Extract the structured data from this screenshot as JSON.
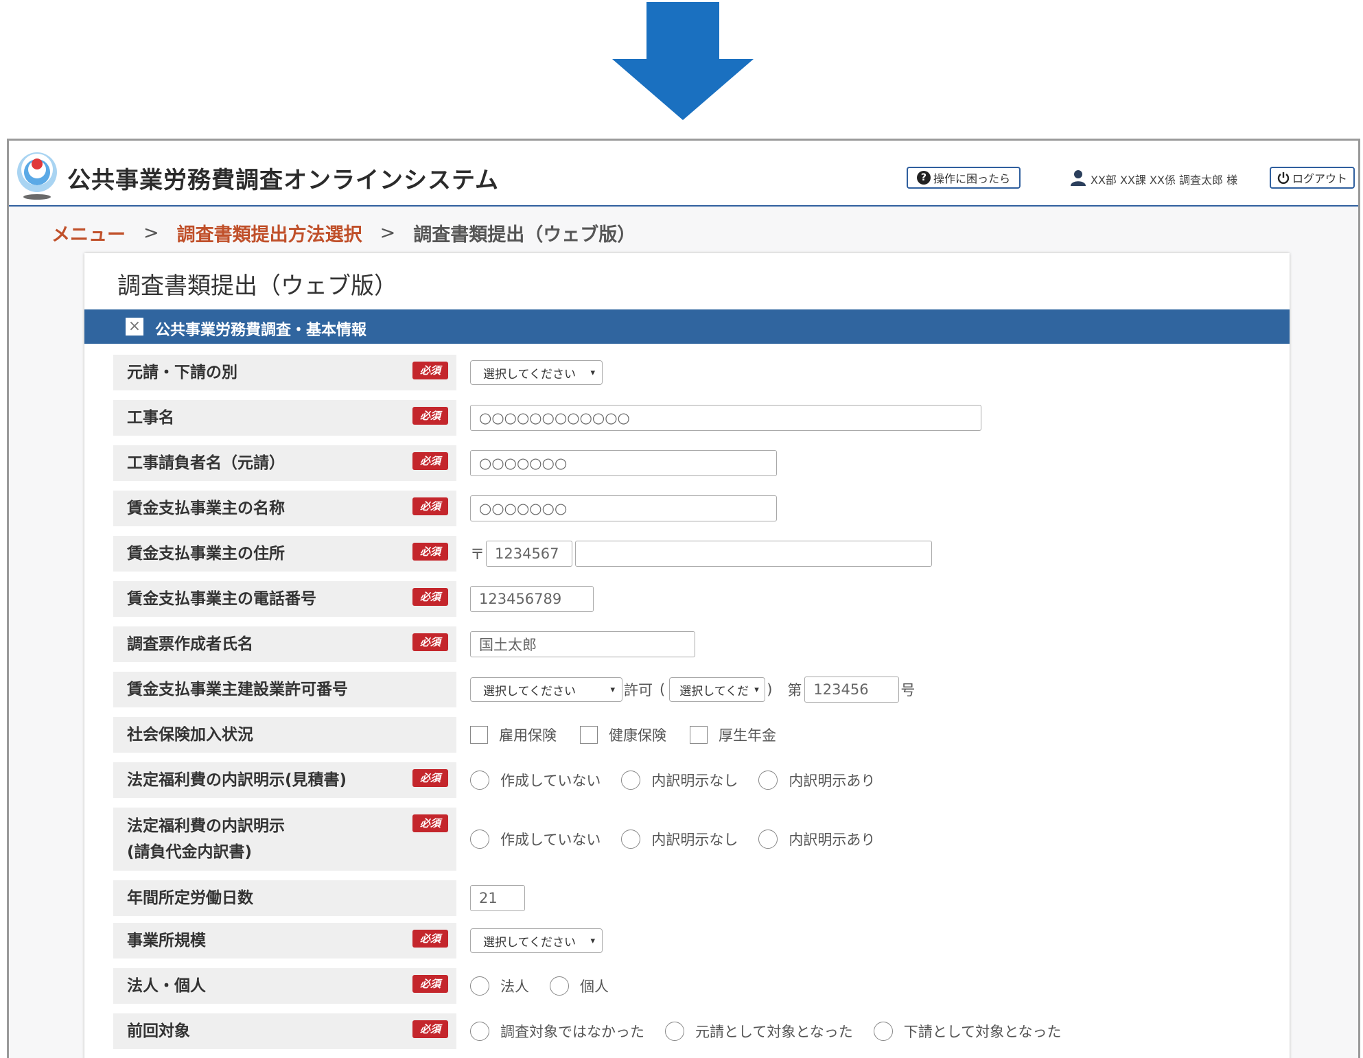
{
  "app": {
    "title": "公共事業労務費調査オンラインシステム",
    "help_label": "操作に困ったら",
    "user_label": "XX部 XX課 XX係 調査太郎 様",
    "logout_label": "ログアウト"
  },
  "breadcrumb": {
    "items": [
      "メニュー",
      "調査書類提出方法選択",
      "調査書類提出（ウェブ版）"
    ],
    "separator": ">"
  },
  "page": {
    "title": "調査書類提出（ウェブ版）",
    "section_title": "公共事業労務費調査・基本情報",
    "required_label": "必須"
  },
  "form": {
    "prime_sub": {
      "label": "元請・下請の別",
      "select": "選択してください"
    },
    "project_name": {
      "label": "工事名",
      "value": "○○○○○○○○○○○○"
    },
    "contractor_name": {
      "label": "工事請負者名（元請）",
      "value": "○○○○○○○"
    },
    "employer_name": {
      "label": "賃金支払事業主の名称",
      "value": "○○○○○○○"
    },
    "employer_address": {
      "label": "賃金支払事業主の住所",
      "postal_mark": "〒",
      "postal_code": "1234567",
      "address": ""
    },
    "employer_phone": {
      "label": "賃金支払事業主の電話番号",
      "value": "123456789"
    },
    "preparer_name": {
      "label": "調査票作成者氏名",
      "value": "国土太郎"
    },
    "license_number": {
      "label": "賃金支払事業主建設業許可番号",
      "select1": "選択してください",
      "permit_text": "許可",
      "open_paren": "(",
      "select2": "選択してくだ",
      "close_paren": ")",
      "dai_text": "第",
      "number": "123456",
      "go_text": "号"
    },
    "social_insurance": {
      "label": "社会保険加入状況",
      "options": [
        "雇用保険",
        "健康保険",
        "厚生年金"
      ]
    },
    "welfare_estimate": {
      "label": "法定福利費の内訳明示(見積書)",
      "options": [
        "作成していない",
        "内訳明示なし",
        "内訳明示あり"
      ]
    },
    "welfare_contract": {
      "label_line1": "法定福利費の内訳明示",
      "label_line2": "(請負代金内訳書)",
      "options": [
        "作成していない",
        "内訳明示なし",
        "内訳明示あり"
      ]
    },
    "annual_workdays": {
      "label": "年間所定労働日数",
      "value": "21"
    },
    "business_scale": {
      "label": "事業所規模",
      "select": "選択してください"
    },
    "corp_individual": {
      "label": "法人・個人",
      "options": [
        "法人",
        "個人"
      ]
    },
    "previous_target": {
      "label": "前回対象",
      "options": [
        "調査対象ではなかった",
        "元請として対象となった",
        "下請として対象となった"
      ]
    }
  },
  "colors": {
    "brand_blue": "#30659f",
    "required_red": "#c4262c",
    "breadcrumb_link": "#c0502a",
    "arrow_blue": "#1a70c0"
  }
}
